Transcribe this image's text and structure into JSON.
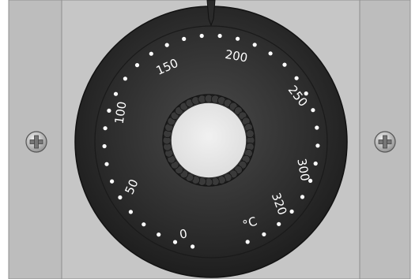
{
  "thermostat": {
    "scale_labels": [
      {
        "text": "0"
      },
      {
        "text": "50"
      },
      {
        "text": "100"
      },
      {
        "text": "150"
      },
      {
        "text": "200"
      },
      {
        "text": "250"
      },
      {
        "text": "300"
      },
      {
        "text": "320"
      },
      {
        "text": "°C"
      }
    ],
    "colors": {
      "panel": "#c4c4c4",
      "side_panel": "#bdbdbd",
      "dial_outer": "#2b2b2b",
      "dial_inner": "#383838",
      "center_cap": "#e9e9e9",
      "tick": "#ffffff"
    },
    "icons": {
      "left_screw": "screw-icon",
      "right_screw": "screw-icon",
      "pointer": "pointer-icon"
    }
  }
}
